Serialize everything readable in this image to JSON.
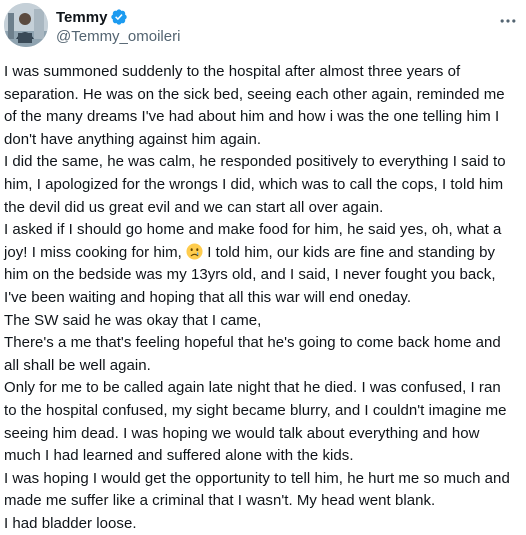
{
  "author": {
    "display_name": "Temmy",
    "handle": "@Temmy_omoileri",
    "verified": true,
    "verified_color": "#1d9bf0",
    "avatar_icon": "user-avatar-photo"
  },
  "menu": {
    "icon": "more-horizontal-icon"
  },
  "tweet": {
    "paragraphs": [
      "I was summoned suddenly to the hospital after almost three years of separation. He was on the sick bed, seeing each other again, reminded me of the many dreams I've had about him and how i was the one telling him I don't have anything against him again.",
      "I did the same, he was calm, he responded positively to everything I said to him, I apologized for the wrongs I did, which was to call the cops, I told him the devil did us great evil and we can start all over again.",
      {
        "before_emoji": "I asked if I should go home and make food for him, he said yes, oh, what a joy! I miss cooking for him, ",
        "emoji": "😢",
        "after_emoji": " I told him, our kids are fine and standing by him on the bedside was my 13yrs old, and I said, I never fought you back, I've been waiting and hoping that all this war will end oneday."
      },
      "The SW said he was okay that I came,",
      "There's a me that's feeling hopeful that he's going to come back home and all shall be well again.",
      "Only for me to be called again late night that he died. I was confused, I ran to the hospital confused, my sight became blurry, and I couldn't imagine me seeing him dead. I was hoping we would talk about everything and how much I had learned and suffered alone with the kids.",
      "I was hoping I would get the opportunity to tell him, he hurt me so much and made me suffer like a criminal that I wasn't. My head went blank.",
      "I had bladder loose."
    ]
  }
}
